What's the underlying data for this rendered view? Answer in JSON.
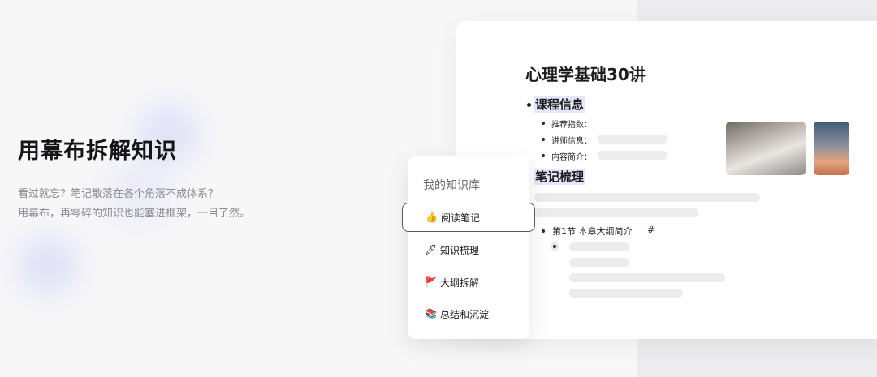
{
  "hero": {
    "title": "用幕布拆解知识",
    "desc_line1": "看过就忘？笔记散落在各个角落不成体系？",
    "desc_line2": "用幕布，再零碎的知识也能塞进框架，一目了然。"
  },
  "document": {
    "title": "心理学基础30讲",
    "section1": {
      "heading": "课程信息",
      "fields": [
        {
          "label": "推荐指数："
        },
        {
          "label": "讲师信息："
        },
        {
          "label": "内容简介："
        }
      ]
    },
    "section2": {
      "heading": "笔记梳理",
      "chapter": "第1节 本章大纲简介",
      "chapter_anchor": "#"
    }
  },
  "library_menu": {
    "title": "我的知识库",
    "items": [
      {
        "label": "阅读笔记",
        "icon": "thumb-icon",
        "glyph": "👍"
      },
      {
        "label": "知识梳理",
        "icon": "pen-icon",
        "glyph": "🖊"
      },
      {
        "label": "大纲拆解",
        "icon": "flag-icon",
        "glyph": "🚩"
      },
      {
        "label": "总结和沉淀",
        "icon": "books-icon",
        "glyph": "📚"
      }
    ],
    "active_index": 0
  }
}
